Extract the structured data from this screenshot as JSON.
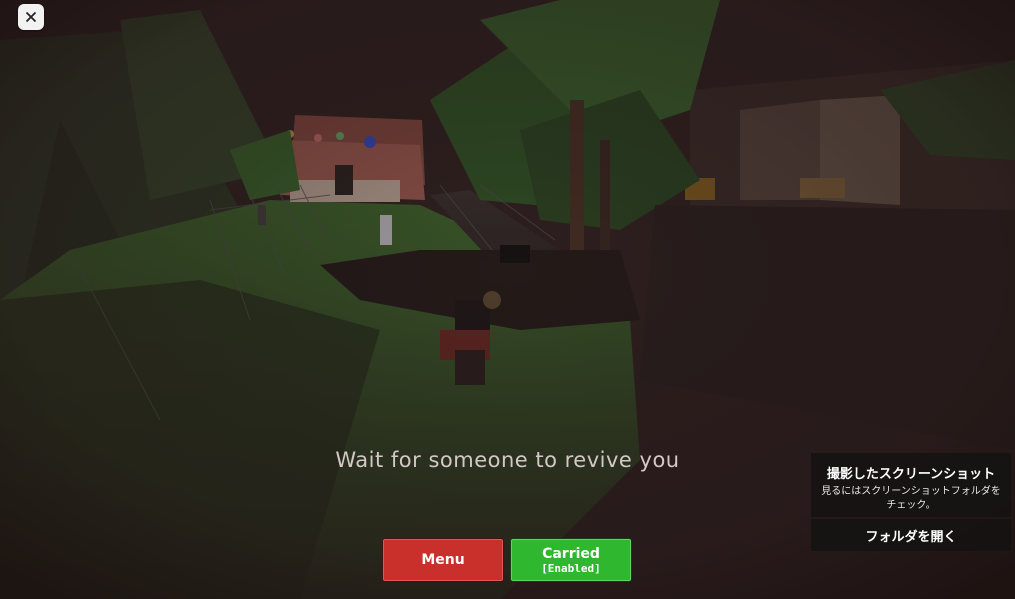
{
  "hud": {
    "close_icon": "close-icon",
    "status_message": "Wait for someone to revive you"
  },
  "buttons": {
    "menu_label": "Menu",
    "carried_label": "Carried",
    "carried_state": "[Enabled]"
  },
  "screenshot_toast": {
    "title": "撮影したスクリーンショット",
    "message": "見るにはスクリーンショットフォルダを チェック。",
    "action_label": "フォルダを開く"
  },
  "colors": {
    "menu_button": "#c9302c",
    "carried_button": "#2fb82f",
    "status_text": "#d3c7c7"
  }
}
